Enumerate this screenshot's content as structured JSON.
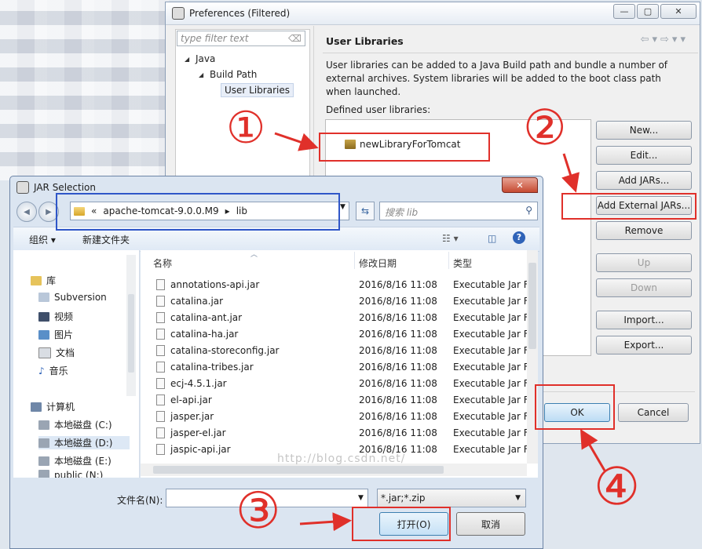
{
  "preferences": {
    "title": "Preferences (Filtered)",
    "window_buttons": {
      "minimize": "—",
      "maximize": "▢",
      "close": "✕"
    },
    "filter_placeholder": "type filter text",
    "tree": [
      "Java",
      "Build Path",
      "User Libraries"
    ],
    "page_title": "User Libraries",
    "description": "User libraries can be added to a Java Build path and bundle a number of external archives. System libraries will be added to the boot class path when launched.",
    "defined_label": "Defined user libraries:",
    "library": "newLibraryForTomcat",
    "buttons": {
      "new": "New...",
      "edit": "Edit...",
      "add_jars": "Add JARs...",
      "add_external_jars": "Add External JARs...",
      "remove": "Remove",
      "up": "Up",
      "down": "Down",
      "import": "Import...",
      "export": "Export...",
      "ok": "OK",
      "cancel": "Cancel"
    }
  },
  "jar_dialog": {
    "title": "JAR Selection",
    "close": "✕",
    "breadcrumb": {
      "prefix": "«",
      "folder": "apache-tomcat-9.0.0.M9",
      "sep": "▸",
      "sub": "lib"
    },
    "search_placeholder": "搜索 lib",
    "toolbar": {
      "organize": "组织 ▾",
      "new_folder": "新建文件夹"
    },
    "nav": {
      "library": "库",
      "items": [
        "Subversion",
        "视频",
        "图片",
        "文档",
        "音乐"
      ],
      "computer": "计算机",
      "drives": [
        "本地磁盘 (C:)",
        "本地磁盘 (D:)",
        "本地磁盘 (E:)",
        "public (N:)"
      ]
    },
    "columns": {
      "name": "名称",
      "date": "修改日期",
      "type": "类型"
    },
    "files": [
      {
        "name": "annotations-api.jar",
        "date": "2016/8/16 11:08",
        "type": "Executable Jar File"
      },
      {
        "name": "catalina.jar",
        "date": "2016/8/16 11:08",
        "type": "Executable Jar File"
      },
      {
        "name": "catalina-ant.jar",
        "date": "2016/8/16 11:08",
        "type": "Executable Jar File"
      },
      {
        "name": "catalina-ha.jar",
        "date": "2016/8/16 11:08",
        "type": "Executable Jar File"
      },
      {
        "name": "catalina-storeconfig.jar",
        "date": "2016/8/16 11:08",
        "type": "Executable Jar File"
      },
      {
        "name": "catalina-tribes.jar",
        "date": "2016/8/16 11:08",
        "type": "Executable Jar File"
      },
      {
        "name": "ecj-4.5.1.jar",
        "date": "2016/8/16 11:08",
        "type": "Executable Jar File"
      },
      {
        "name": "el-api.jar",
        "date": "2016/8/16 11:08",
        "type": "Executable Jar File"
      },
      {
        "name": "jasper.jar",
        "date": "2016/8/16 11:08",
        "type": "Executable Jar File"
      },
      {
        "name": "jasper-el.jar",
        "date": "2016/8/16 11:08",
        "type": "Executable Jar File"
      },
      {
        "name": "jaspic-api.jar",
        "date": "2016/8/16 11:08",
        "type": "Executable Jar File"
      }
    ],
    "watermark": "http://blog.csdn.net/",
    "filename_label": "文件名(N):",
    "filename_value": "",
    "filetype": "*.jar;*.zip",
    "open": "打开(O)",
    "cancel": "取消"
  },
  "annotations": {
    "step1": "①",
    "step2": "②",
    "step3": "③",
    "step4": "④",
    "color": "#e0302a",
    "highlight_color": "#2f56c8"
  }
}
